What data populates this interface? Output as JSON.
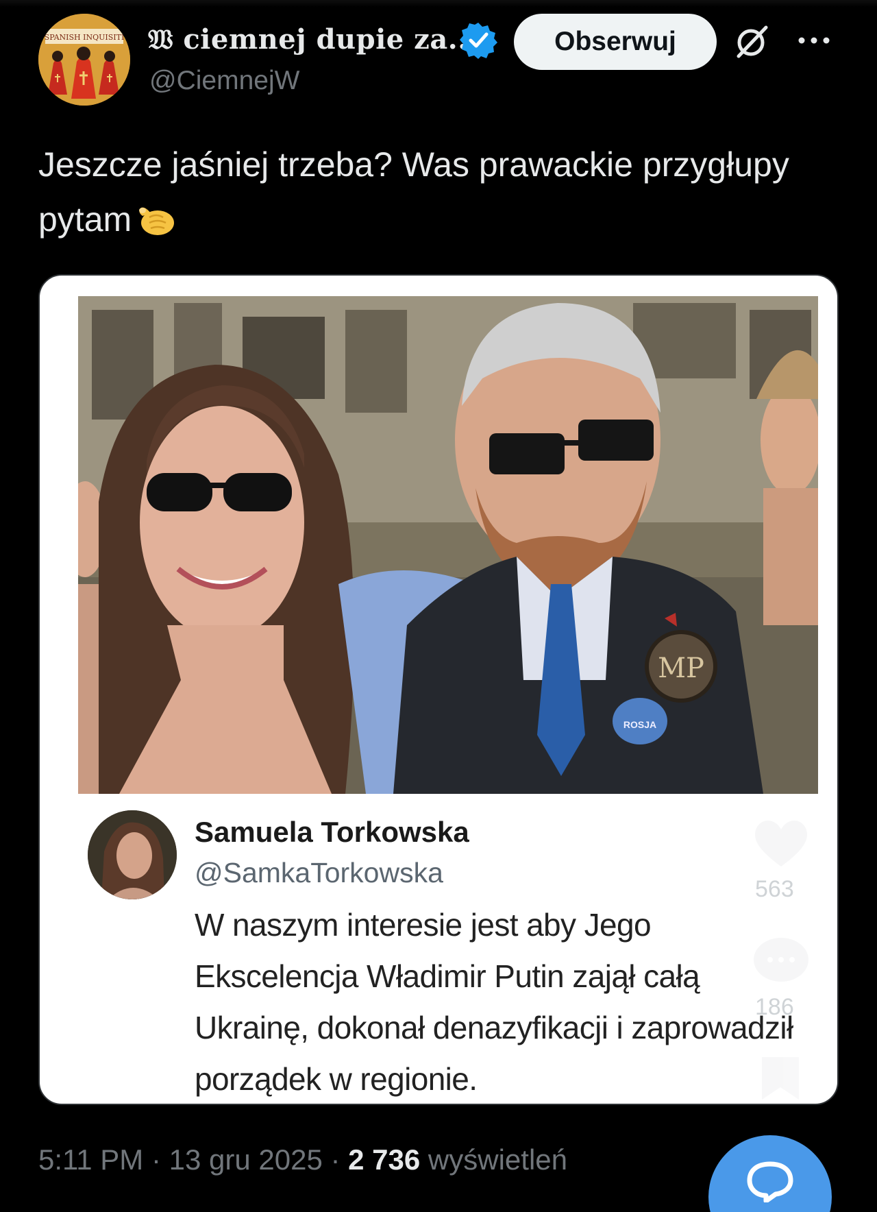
{
  "author": {
    "display_name": "𝔚 ciemnej dupie za...",
    "handle": "@CiemnejW",
    "avatar_text": "SPANISH INQUISITI",
    "verified_icon": "verified-badge-icon",
    "follow_label": "Obserwuj"
  },
  "tweet": {
    "text": "Jeszcze jaśniej trzeba? Was prawackie przygłupy pytam",
    "emoji": "pointing-hand-emoji"
  },
  "media": {
    "embedded": {
      "name": "Samuela Torkowska",
      "handle": "@SamkaTorkowska",
      "text": "W naszym interesie jest aby Jego Ekscelencja Władimir Putin zajął całą Ukrainę, dokonał denazyfikacji i zaprowadził porządek w regionie.",
      "likes": "563",
      "comments": "186"
    },
    "watermark_text": "MP",
    "badge_text": "ROSJA"
  },
  "footer": {
    "time": "5:11 PM",
    "sep1": " · ",
    "date": "13 gru 2025",
    "sep2": " · ",
    "views": "2 736",
    "views_label": " wyświetleń"
  },
  "colors": {
    "background": "#000000",
    "accent": "#4a99e9",
    "verified": "#1d9bf0",
    "muted": "#71767b"
  }
}
